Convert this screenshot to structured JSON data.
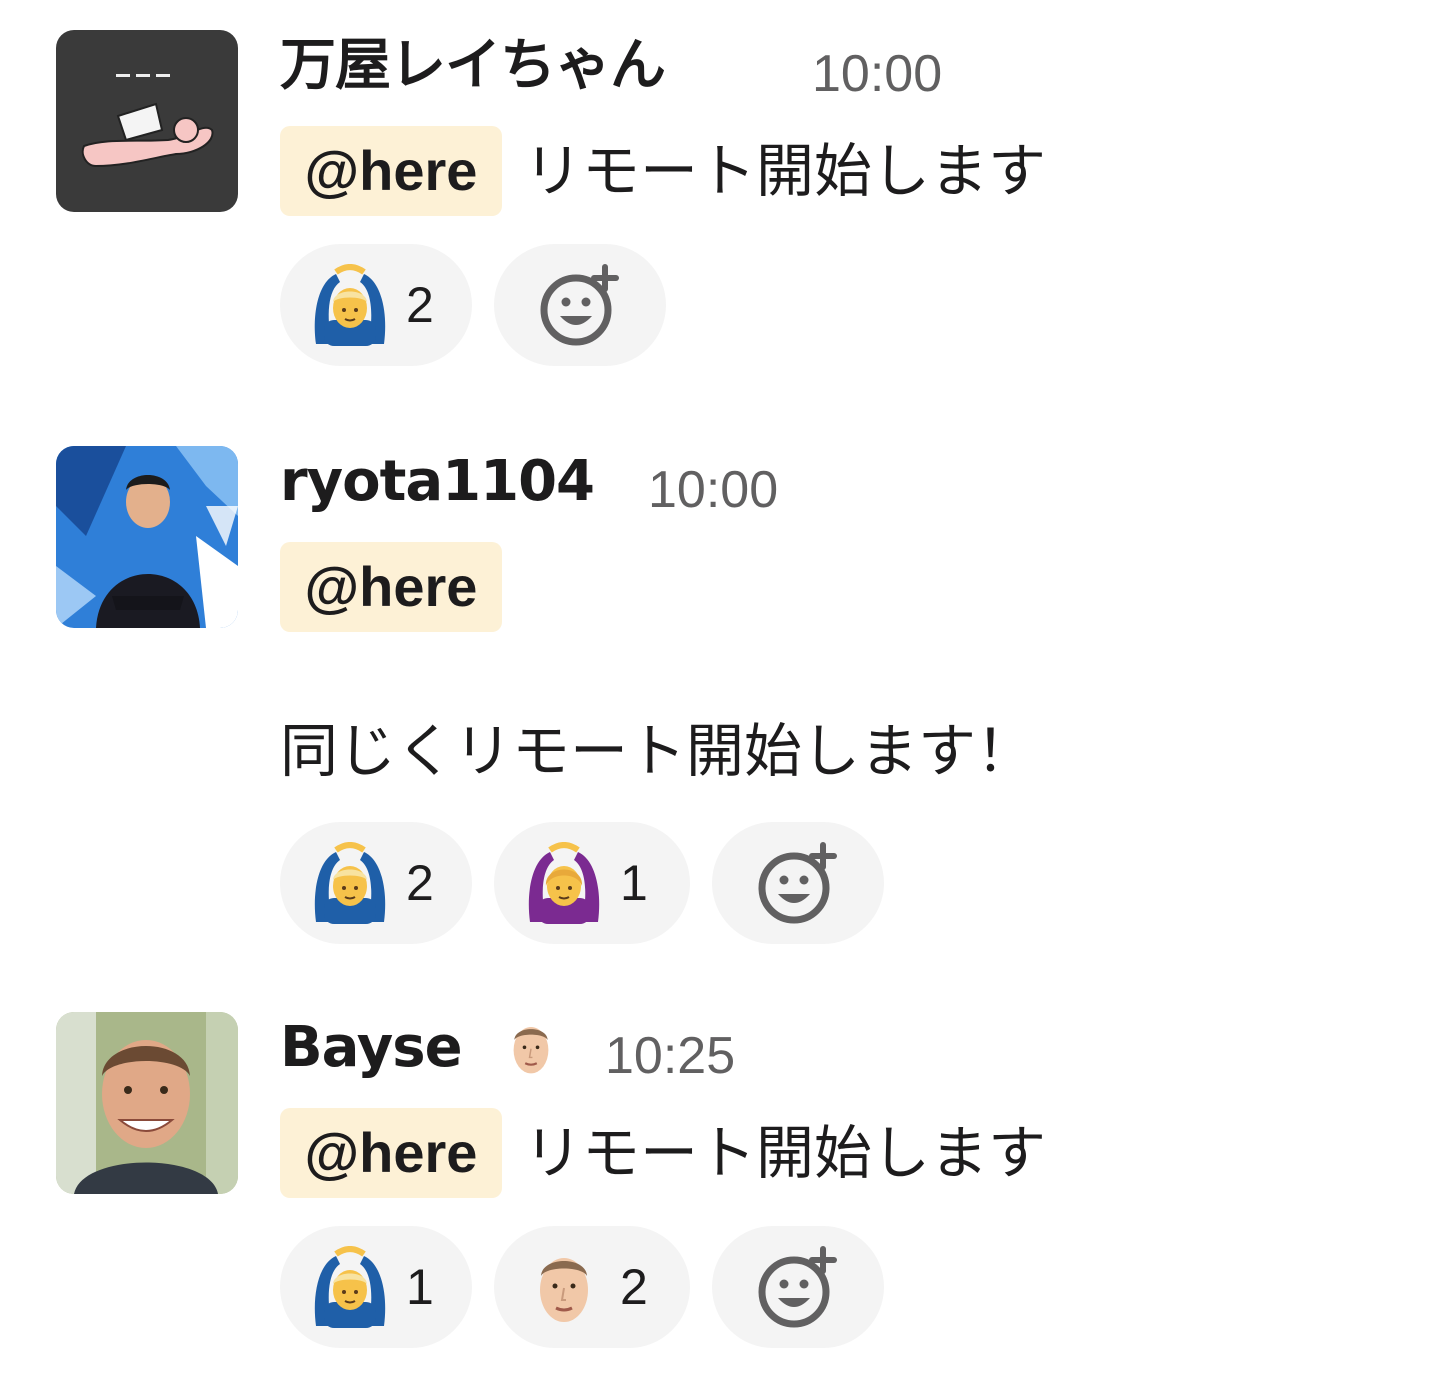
{
  "messages": [
    {
      "username": "万屋レイちゃん",
      "timestamp": "10:00",
      "mention": "@here",
      "text": "リモート開始します",
      "reactions": [
        {
          "emoji": "person-gesturing-ok-man",
          "count": "2"
        }
      ]
    },
    {
      "username": "ryota1104",
      "timestamp": "10:00",
      "mention": "@here",
      "text": "",
      "extra_text": "同じくリモート開始します！",
      "reactions": [
        {
          "emoji": "person-gesturing-ok-man",
          "count": "2"
        },
        {
          "emoji": "person-gesturing-ok-woman",
          "count": "1"
        }
      ]
    },
    {
      "username": "Bayse",
      "status_emoji": "custom-face",
      "timestamp": "10:25",
      "mention": "@here",
      "text": "リモート開始します",
      "reactions": [
        {
          "emoji": "person-gesturing-ok-man",
          "count": "1"
        },
        {
          "emoji": "custom-face",
          "count": "2"
        }
      ]
    }
  ],
  "colors": {
    "mention_bg": "#fdf1d6",
    "reaction_bg": "#f4f4f4",
    "timestamp": "#616061",
    "text": "#1d1c1d"
  }
}
